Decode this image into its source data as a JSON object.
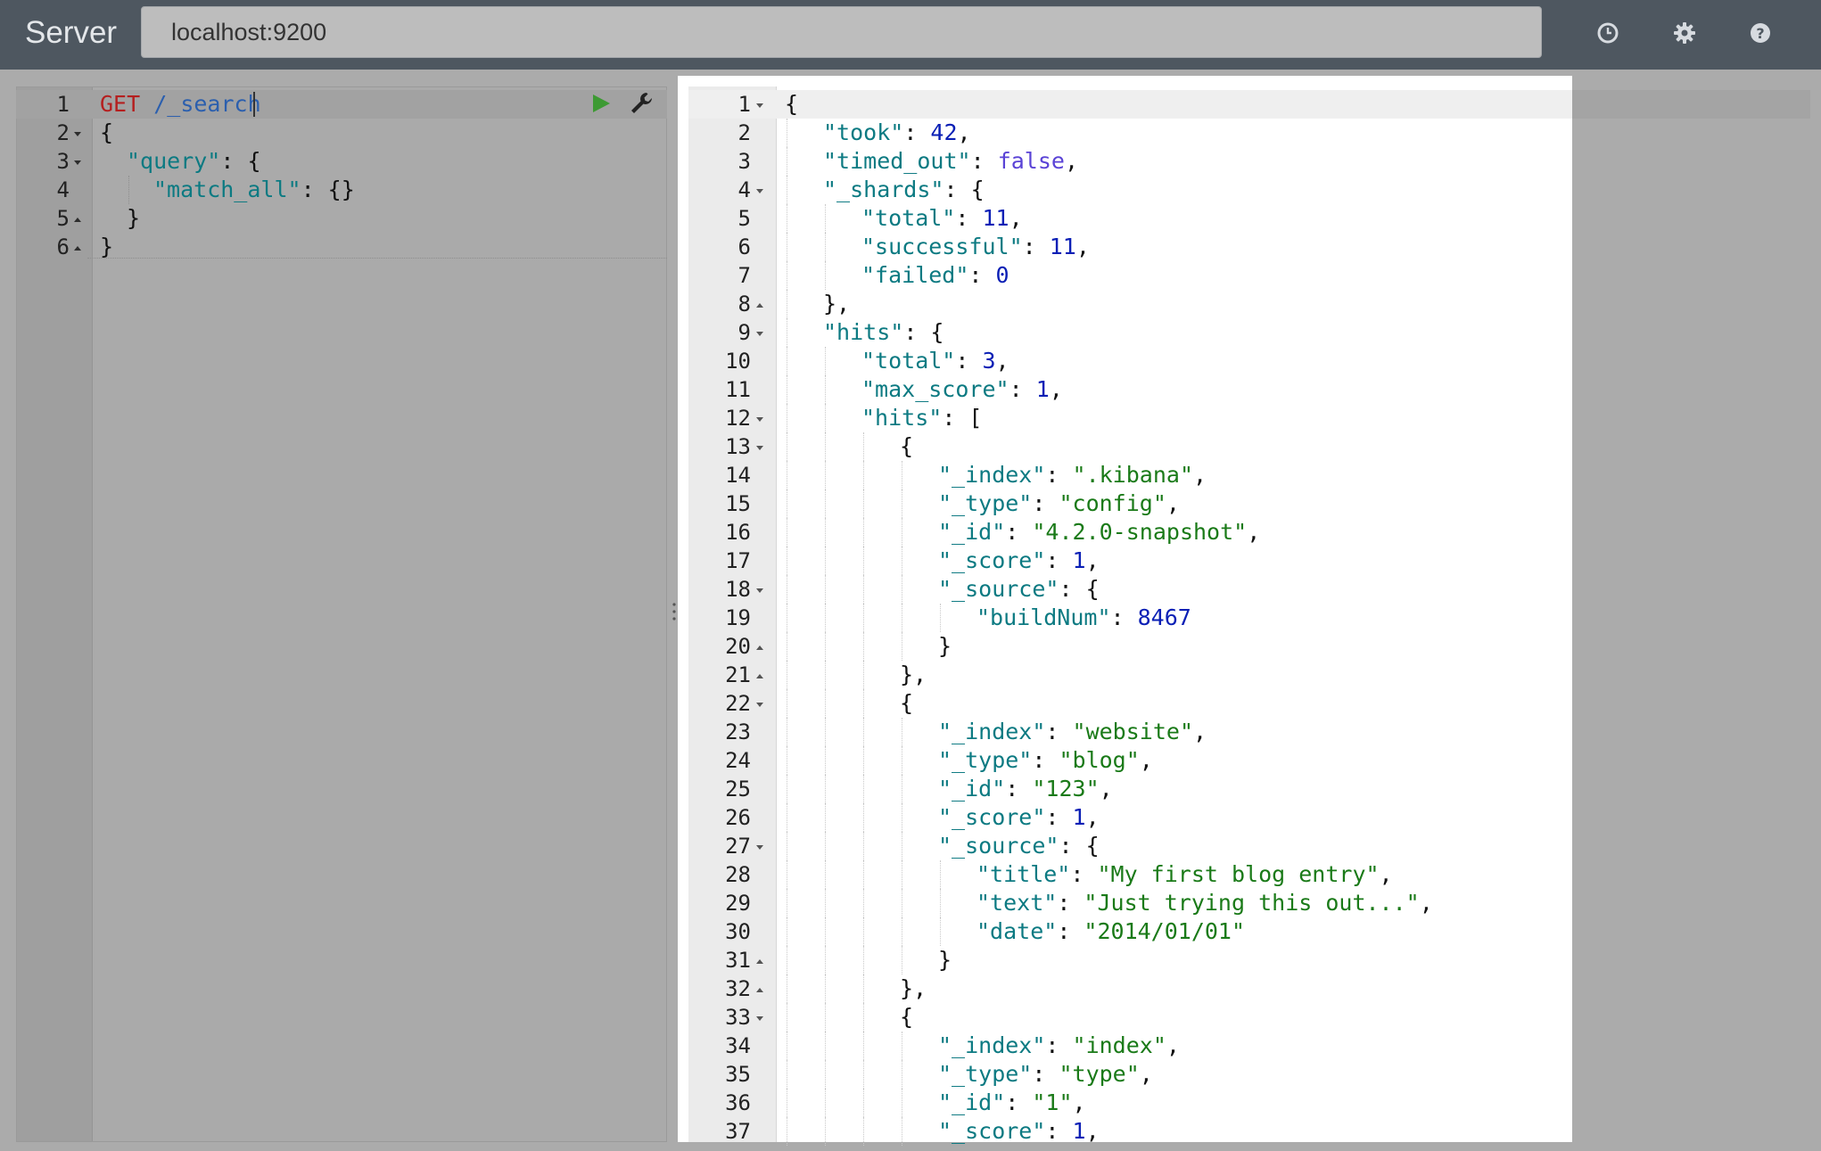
{
  "topbar": {
    "brand": "Server",
    "server_url": "localhost:9200",
    "icons": [
      "history-icon",
      "settings-icon",
      "help-icon"
    ]
  },
  "request_editor": {
    "lines": [
      {
        "n": "1",
        "fold": "",
        "indent": 0,
        "tokens": [
          {
            "t": "GET",
            "c": "m"
          },
          {
            "t": " ",
            "c": "p"
          },
          {
            "t": "/_search",
            "c": "u"
          }
        ]
      },
      {
        "n": "2",
        "fold": "down",
        "indent": 0,
        "tokens": [
          {
            "t": "{",
            "c": "p"
          }
        ]
      },
      {
        "n": "3",
        "fold": "down",
        "indent": 1,
        "tokens": [
          {
            "t": "\"query\"",
            "c": "k"
          },
          {
            "t": ": {",
            "c": "p"
          }
        ]
      },
      {
        "n": "4",
        "fold": "",
        "indent": 2,
        "tokens": [
          {
            "t": "\"match_all\"",
            "c": "k"
          },
          {
            "t": ": {}",
            "c": "p"
          }
        ]
      },
      {
        "n": "5",
        "fold": "up",
        "indent": 1,
        "tokens": [
          {
            "t": "}",
            "c": "p"
          }
        ]
      },
      {
        "n": "6",
        "fold": "up",
        "indent": 0,
        "tokens": [
          {
            "t": "}",
            "c": "p"
          }
        ]
      }
    ]
  },
  "response_viewer": {
    "lines": [
      {
        "n": "1",
        "fold": "down",
        "indent": 0,
        "tokens": [
          {
            "t": "{",
            "c": "p"
          }
        ]
      },
      {
        "n": "2",
        "fold": "",
        "indent": 1,
        "tokens": [
          {
            "t": "\"took\"",
            "c": "k"
          },
          {
            "t": ": ",
            "c": "p"
          },
          {
            "t": "42",
            "c": "n"
          },
          {
            "t": ",",
            "c": "p"
          }
        ]
      },
      {
        "n": "3",
        "fold": "",
        "indent": 1,
        "tokens": [
          {
            "t": "\"timed_out\"",
            "c": "k"
          },
          {
            "t": ": ",
            "c": "p"
          },
          {
            "t": "false",
            "c": "b"
          },
          {
            "t": ",",
            "c": "p"
          }
        ]
      },
      {
        "n": "4",
        "fold": "down",
        "indent": 1,
        "tokens": [
          {
            "t": "\"_shards\"",
            "c": "k"
          },
          {
            "t": ": {",
            "c": "p"
          }
        ]
      },
      {
        "n": "5",
        "fold": "",
        "indent": 2,
        "tokens": [
          {
            "t": "\"total\"",
            "c": "k"
          },
          {
            "t": ": ",
            "c": "p"
          },
          {
            "t": "11",
            "c": "n"
          },
          {
            "t": ",",
            "c": "p"
          }
        ]
      },
      {
        "n": "6",
        "fold": "",
        "indent": 2,
        "tokens": [
          {
            "t": "\"successful\"",
            "c": "k"
          },
          {
            "t": ": ",
            "c": "p"
          },
          {
            "t": "11",
            "c": "n"
          },
          {
            "t": ",",
            "c": "p"
          }
        ]
      },
      {
        "n": "7",
        "fold": "",
        "indent": 2,
        "tokens": [
          {
            "t": "\"failed\"",
            "c": "k"
          },
          {
            "t": ": ",
            "c": "p"
          },
          {
            "t": "0",
            "c": "n"
          }
        ]
      },
      {
        "n": "8",
        "fold": "up",
        "indent": 1,
        "tokens": [
          {
            "t": "},",
            "c": "p"
          }
        ]
      },
      {
        "n": "9",
        "fold": "down",
        "indent": 1,
        "tokens": [
          {
            "t": "\"hits\"",
            "c": "k"
          },
          {
            "t": ": {",
            "c": "p"
          }
        ]
      },
      {
        "n": "10",
        "fold": "",
        "indent": 2,
        "tokens": [
          {
            "t": "\"total\"",
            "c": "k"
          },
          {
            "t": ": ",
            "c": "p"
          },
          {
            "t": "3",
            "c": "n"
          },
          {
            "t": ",",
            "c": "p"
          }
        ]
      },
      {
        "n": "11",
        "fold": "",
        "indent": 2,
        "tokens": [
          {
            "t": "\"max_score\"",
            "c": "k"
          },
          {
            "t": ": ",
            "c": "p"
          },
          {
            "t": "1",
            "c": "n"
          },
          {
            "t": ",",
            "c": "p"
          }
        ]
      },
      {
        "n": "12",
        "fold": "down",
        "indent": 2,
        "tokens": [
          {
            "t": "\"hits\"",
            "c": "k"
          },
          {
            "t": ": [",
            "c": "p"
          }
        ]
      },
      {
        "n": "13",
        "fold": "down",
        "indent": 3,
        "tokens": [
          {
            "t": "{",
            "c": "p"
          }
        ]
      },
      {
        "n": "14",
        "fold": "",
        "indent": 4,
        "tokens": [
          {
            "t": "\"_index\"",
            "c": "k"
          },
          {
            "t": ": ",
            "c": "p"
          },
          {
            "t": "\".kibana\"",
            "c": "s"
          },
          {
            "t": ",",
            "c": "p"
          }
        ]
      },
      {
        "n": "15",
        "fold": "",
        "indent": 4,
        "tokens": [
          {
            "t": "\"_type\"",
            "c": "k"
          },
          {
            "t": ": ",
            "c": "p"
          },
          {
            "t": "\"config\"",
            "c": "s"
          },
          {
            "t": ",",
            "c": "p"
          }
        ]
      },
      {
        "n": "16",
        "fold": "",
        "indent": 4,
        "tokens": [
          {
            "t": "\"_id\"",
            "c": "k"
          },
          {
            "t": ": ",
            "c": "p"
          },
          {
            "t": "\"4.2.0-snapshot\"",
            "c": "s"
          },
          {
            "t": ",",
            "c": "p"
          }
        ]
      },
      {
        "n": "17",
        "fold": "",
        "indent": 4,
        "tokens": [
          {
            "t": "\"_score\"",
            "c": "k"
          },
          {
            "t": ": ",
            "c": "p"
          },
          {
            "t": "1",
            "c": "n"
          },
          {
            "t": ",",
            "c": "p"
          }
        ]
      },
      {
        "n": "18",
        "fold": "down",
        "indent": 4,
        "tokens": [
          {
            "t": "\"_source\"",
            "c": "k"
          },
          {
            "t": ": {",
            "c": "p"
          }
        ]
      },
      {
        "n": "19",
        "fold": "",
        "indent": 5,
        "tokens": [
          {
            "t": "\"buildNum\"",
            "c": "k"
          },
          {
            "t": ": ",
            "c": "p"
          },
          {
            "t": "8467",
            "c": "n"
          }
        ]
      },
      {
        "n": "20",
        "fold": "up",
        "indent": 4,
        "tokens": [
          {
            "t": "}",
            "c": "p"
          }
        ]
      },
      {
        "n": "21",
        "fold": "up",
        "indent": 3,
        "tokens": [
          {
            "t": "},",
            "c": "p"
          }
        ]
      },
      {
        "n": "22",
        "fold": "down",
        "indent": 3,
        "tokens": [
          {
            "t": "{",
            "c": "p"
          }
        ]
      },
      {
        "n": "23",
        "fold": "",
        "indent": 4,
        "tokens": [
          {
            "t": "\"_index\"",
            "c": "k"
          },
          {
            "t": ": ",
            "c": "p"
          },
          {
            "t": "\"website\"",
            "c": "s"
          },
          {
            "t": ",",
            "c": "p"
          }
        ]
      },
      {
        "n": "24",
        "fold": "",
        "indent": 4,
        "tokens": [
          {
            "t": "\"_type\"",
            "c": "k"
          },
          {
            "t": ": ",
            "c": "p"
          },
          {
            "t": "\"blog\"",
            "c": "s"
          },
          {
            "t": ",",
            "c": "p"
          }
        ]
      },
      {
        "n": "25",
        "fold": "",
        "indent": 4,
        "tokens": [
          {
            "t": "\"_id\"",
            "c": "k"
          },
          {
            "t": ": ",
            "c": "p"
          },
          {
            "t": "\"123\"",
            "c": "s"
          },
          {
            "t": ",",
            "c": "p"
          }
        ]
      },
      {
        "n": "26",
        "fold": "",
        "indent": 4,
        "tokens": [
          {
            "t": "\"_score\"",
            "c": "k"
          },
          {
            "t": ": ",
            "c": "p"
          },
          {
            "t": "1",
            "c": "n"
          },
          {
            "t": ",",
            "c": "p"
          }
        ]
      },
      {
        "n": "27",
        "fold": "down",
        "indent": 4,
        "tokens": [
          {
            "t": "\"_source\"",
            "c": "k"
          },
          {
            "t": ": {",
            "c": "p"
          }
        ]
      },
      {
        "n": "28",
        "fold": "",
        "indent": 5,
        "tokens": [
          {
            "t": "\"title\"",
            "c": "k"
          },
          {
            "t": ": ",
            "c": "p"
          },
          {
            "t": "\"My first blog entry\"",
            "c": "s"
          },
          {
            "t": ",",
            "c": "p"
          }
        ]
      },
      {
        "n": "29",
        "fold": "",
        "indent": 5,
        "tokens": [
          {
            "t": "\"text\"",
            "c": "k"
          },
          {
            "t": ": ",
            "c": "p"
          },
          {
            "t": "\"Just trying this out...\"",
            "c": "s"
          },
          {
            "t": ",",
            "c": "p"
          }
        ]
      },
      {
        "n": "30",
        "fold": "",
        "indent": 5,
        "tokens": [
          {
            "t": "\"date\"",
            "c": "k"
          },
          {
            "t": ": ",
            "c": "p"
          },
          {
            "t": "\"2014/01/01\"",
            "c": "s"
          }
        ]
      },
      {
        "n": "31",
        "fold": "up",
        "indent": 4,
        "tokens": [
          {
            "t": "}",
            "c": "p"
          }
        ]
      },
      {
        "n": "32",
        "fold": "up",
        "indent": 3,
        "tokens": [
          {
            "t": "},",
            "c": "p"
          }
        ]
      },
      {
        "n": "33",
        "fold": "down",
        "indent": 3,
        "tokens": [
          {
            "t": "{",
            "c": "p"
          }
        ]
      },
      {
        "n": "34",
        "fold": "",
        "indent": 4,
        "tokens": [
          {
            "t": "\"_index\"",
            "c": "k"
          },
          {
            "t": ": ",
            "c": "p"
          },
          {
            "t": "\"index\"",
            "c": "s"
          },
          {
            "t": ",",
            "c": "p"
          }
        ]
      },
      {
        "n": "35",
        "fold": "",
        "indent": 4,
        "tokens": [
          {
            "t": "\"_type\"",
            "c": "k"
          },
          {
            "t": ": ",
            "c": "p"
          },
          {
            "t": "\"type\"",
            "c": "s"
          },
          {
            "t": ",",
            "c": "p"
          }
        ]
      },
      {
        "n": "36",
        "fold": "",
        "indent": 4,
        "tokens": [
          {
            "t": "\"_id\"",
            "c": "k"
          },
          {
            "t": ": ",
            "c": "p"
          },
          {
            "t": "\"1\"",
            "c": "s"
          },
          {
            "t": ",",
            "c": "p"
          }
        ]
      },
      {
        "n": "37",
        "fold": "",
        "indent": 4,
        "tokens": [
          {
            "t": "\"_score\"",
            "c": "k"
          },
          {
            "t": ": ",
            "c": "p"
          },
          {
            "t": "1",
            "c": "n"
          },
          {
            "t": ",",
            "c": "p"
          }
        ]
      }
    ]
  },
  "colors": {
    "topbar": "#4e5760",
    "key": "#0c7a82",
    "string": "#1a7a18",
    "number": "#0a1fb5",
    "boolean": "#5a43d6",
    "method": "#b51f1f",
    "url": "#2b5fae",
    "run": "#3d9a33"
  }
}
